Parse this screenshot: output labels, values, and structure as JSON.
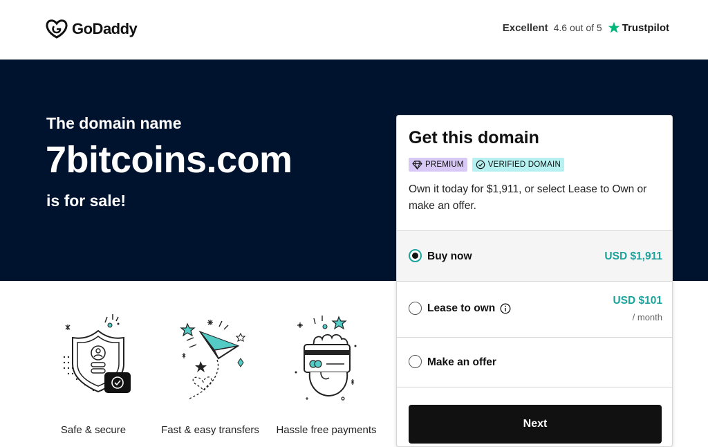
{
  "header": {
    "logo_text": "GoDaddy",
    "rating": {
      "label": "Excellent",
      "score_text": "4.6 out of 5",
      "provider": "Trustpilot"
    }
  },
  "hero": {
    "lead": "The domain name",
    "domain": "7bitcoins.com",
    "tail": "is for sale!"
  },
  "features": [
    {
      "label": "Safe & secure",
      "icon": "shield-check-icon"
    },
    {
      "label": "Fast & easy transfers",
      "icon": "paper-plane-icon"
    },
    {
      "label": "Hassle free payments",
      "icon": "hand-card-icon"
    }
  ],
  "card": {
    "title": "Get this domain",
    "badges": {
      "premium": "PREMIUM",
      "verified": "VERIFIED DOMAIN"
    },
    "description": "Own it today for $1,911, or select Lease to Own or make an offer.",
    "options": {
      "buy": {
        "label": "Buy now",
        "price": "USD $1,911",
        "selected": true
      },
      "lease": {
        "label": "Lease to own",
        "price": "USD $101",
        "per": "/ month",
        "selected": false
      },
      "offer": {
        "label": "Make an offer",
        "selected": false
      }
    },
    "next_label": "Next"
  },
  "colors": {
    "hero_bg": "#00132e",
    "accent_teal": "#1ba39c",
    "premium_badge": "#d8c8f5",
    "verified_badge": "#b6f0f0",
    "trustpilot_star": "#00b67a"
  }
}
